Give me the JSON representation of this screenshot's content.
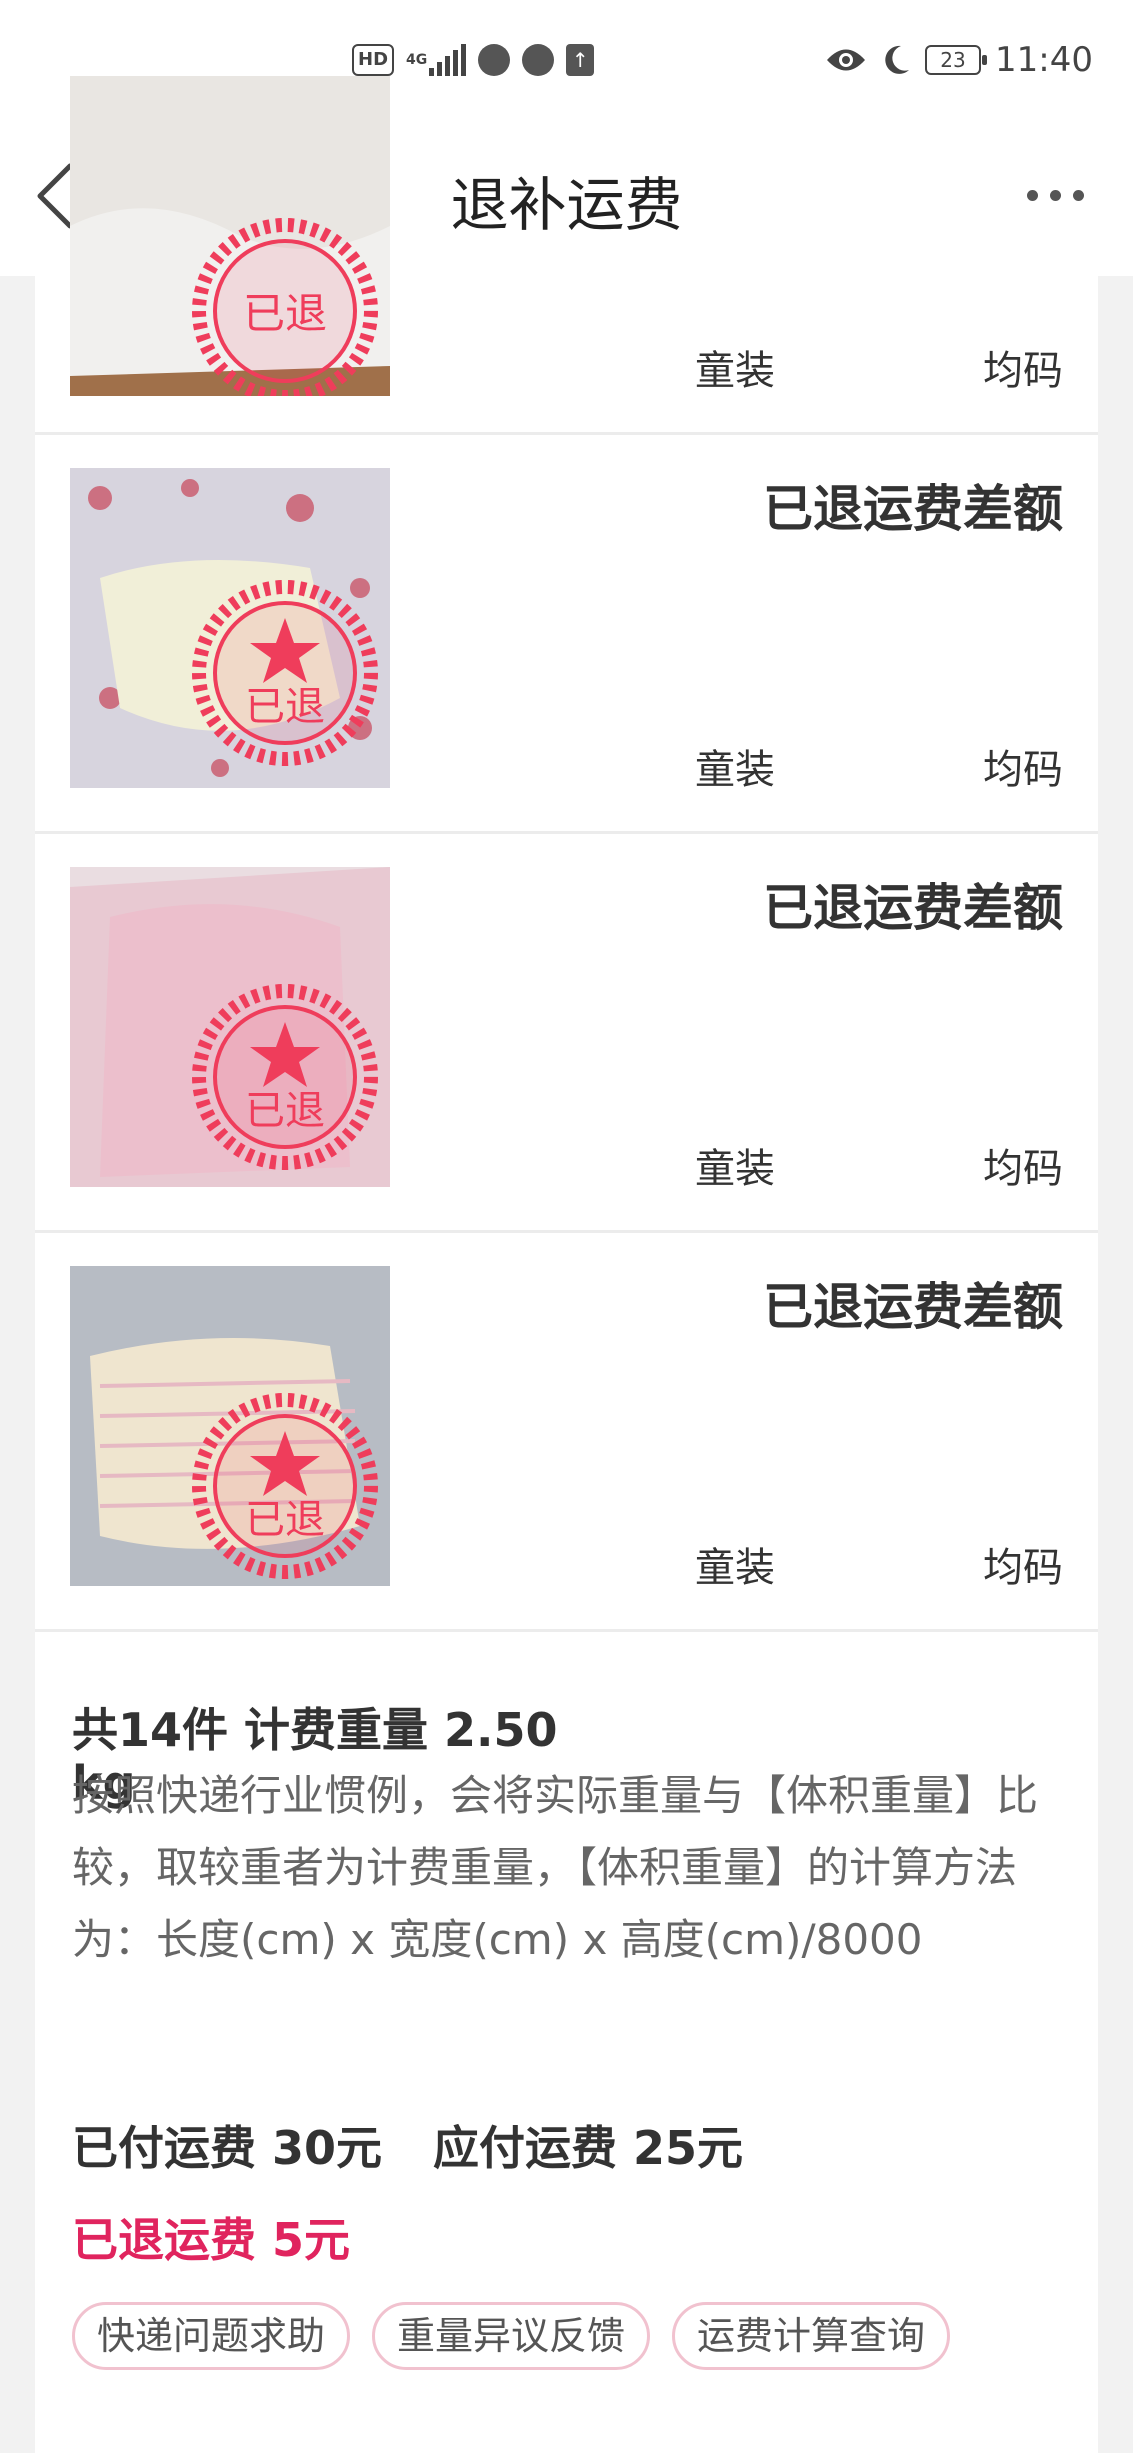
{
  "status_bar": {
    "hd": "HD",
    "network": "4G",
    "battery": "23",
    "time": "11:40",
    "icons": [
      "hd-icon",
      "signal-icon",
      "timer-icon",
      "audio-icon",
      "upload-icon",
      "eye-icon",
      "moon-icon",
      "battery-icon"
    ]
  },
  "nav": {
    "title": "退补运费",
    "back_icon": "chevron-left-icon",
    "more_icon": "more-dots-icon"
  },
  "items": [
    {
      "diff_label": "",
      "category": "童装",
      "size": "均码",
      "stamp": "已退"
    },
    {
      "diff_label": "已退运费差额",
      "category": "童装",
      "size": "均码",
      "stamp": "已退"
    },
    {
      "diff_label": "已退运费差额",
      "category": "童装",
      "size": "均码",
      "stamp": "已退"
    },
    {
      "diff_label": "已退运费差额",
      "category": "童装",
      "size": "均码",
      "stamp": "已退"
    }
  ],
  "summary": {
    "title_line1": "共14件 计费重量 2.50",
    "title_line2": "kg",
    "description": "按照快递行业惯例，会将实际重量与【体积重量】比较，取较重者为计费重量，【体积重量】的计算方法为：长度(cm) x 宽度(cm) x 高度(cm)/8000",
    "paid": "已付运费 30元",
    "due": "应付运费 25元",
    "refunded": "已退运费 5元",
    "tags": [
      "快递问题求助",
      "重量异议反馈",
      "运费计算查询"
    ]
  },
  "colors": {
    "accent": "#e0245e",
    "stamp": "#ef3d5b",
    "tag_border": "#f1c2cf"
  }
}
